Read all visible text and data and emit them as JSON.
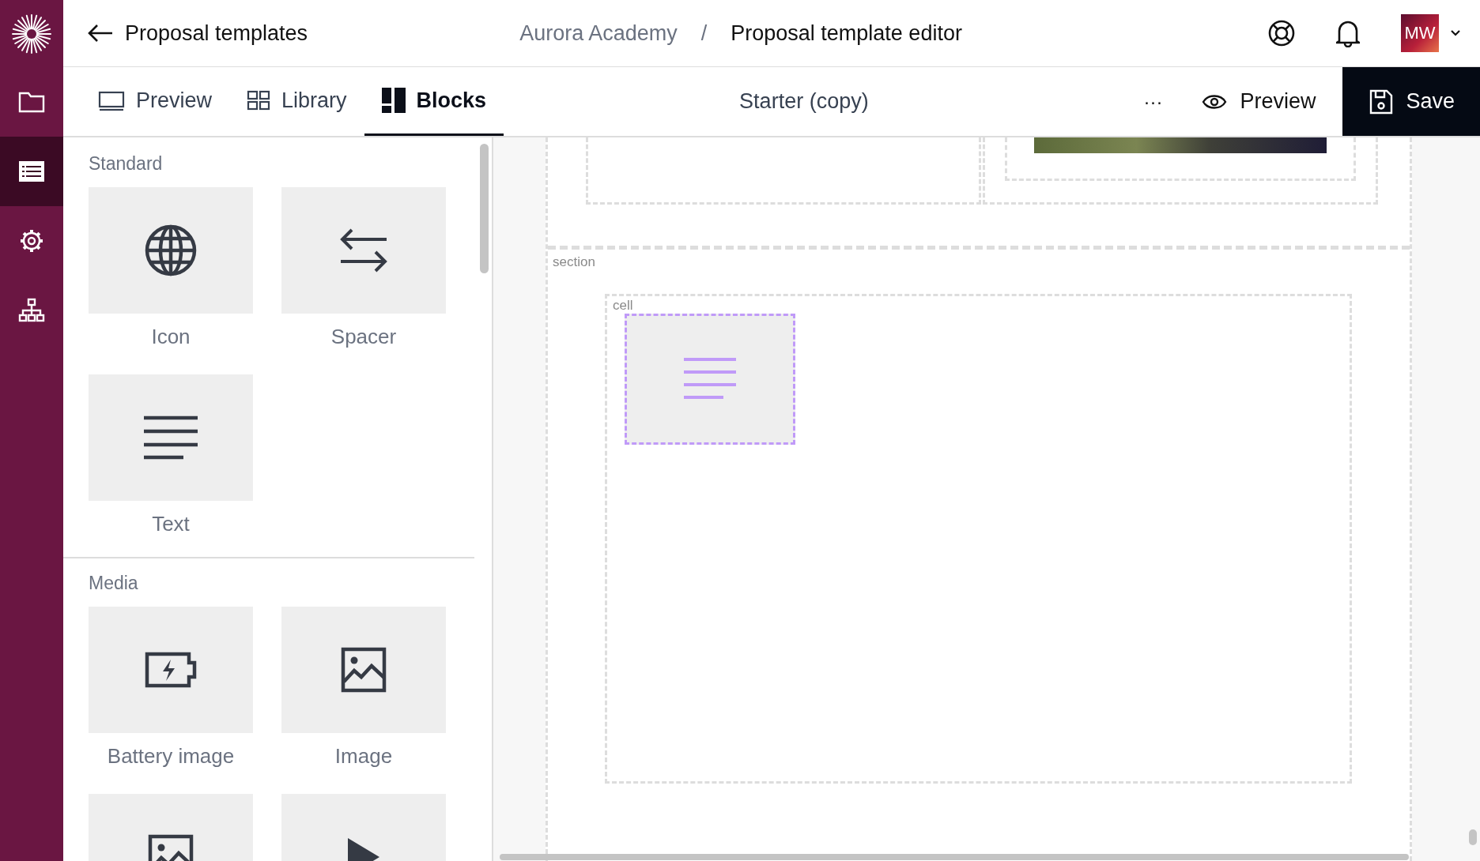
{
  "header": {
    "back_label": "Proposal templates",
    "breadcrumb": [
      "Aurora Academy",
      "Proposal template editor"
    ],
    "separator": "/",
    "avatar_initials": "MW"
  },
  "rail": [
    {
      "kind": "folder",
      "selected": false
    },
    {
      "kind": "list",
      "selected": true
    },
    {
      "kind": "gear",
      "selected": false
    },
    {
      "kind": "hierarchy",
      "selected": false
    }
  ],
  "toolbar": {
    "tabs": [
      {
        "label": "Preview",
        "kind": "preview",
        "selected": false
      },
      {
        "label": "Library",
        "kind": "library",
        "selected": false
      },
      {
        "label": "Blocks",
        "kind": "blocks",
        "selected": true
      }
    ],
    "title": "Starter (copy)",
    "more": "···",
    "preview_button": "Preview",
    "save_button": "Save"
  },
  "palette": {
    "groups": [
      {
        "title": "Standard",
        "blocks": [
          {
            "label": "Icon",
            "kind": "globe"
          },
          {
            "label": "Spacer",
            "kind": "arrows"
          },
          {
            "label": "Text",
            "kind": "text"
          }
        ]
      },
      {
        "title": "Media",
        "blocks": [
          {
            "label": "Battery image",
            "kind": "battery"
          },
          {
            "label": "Image",
            "kind": "image"
          },
          {
            "kind": "image"
          },
          {
            "kind": "play"
          }
        ]
      }
    ]
  },
  "canvas": {
    "section_label": "section",
    "cell_label": "cell"
  }
}
